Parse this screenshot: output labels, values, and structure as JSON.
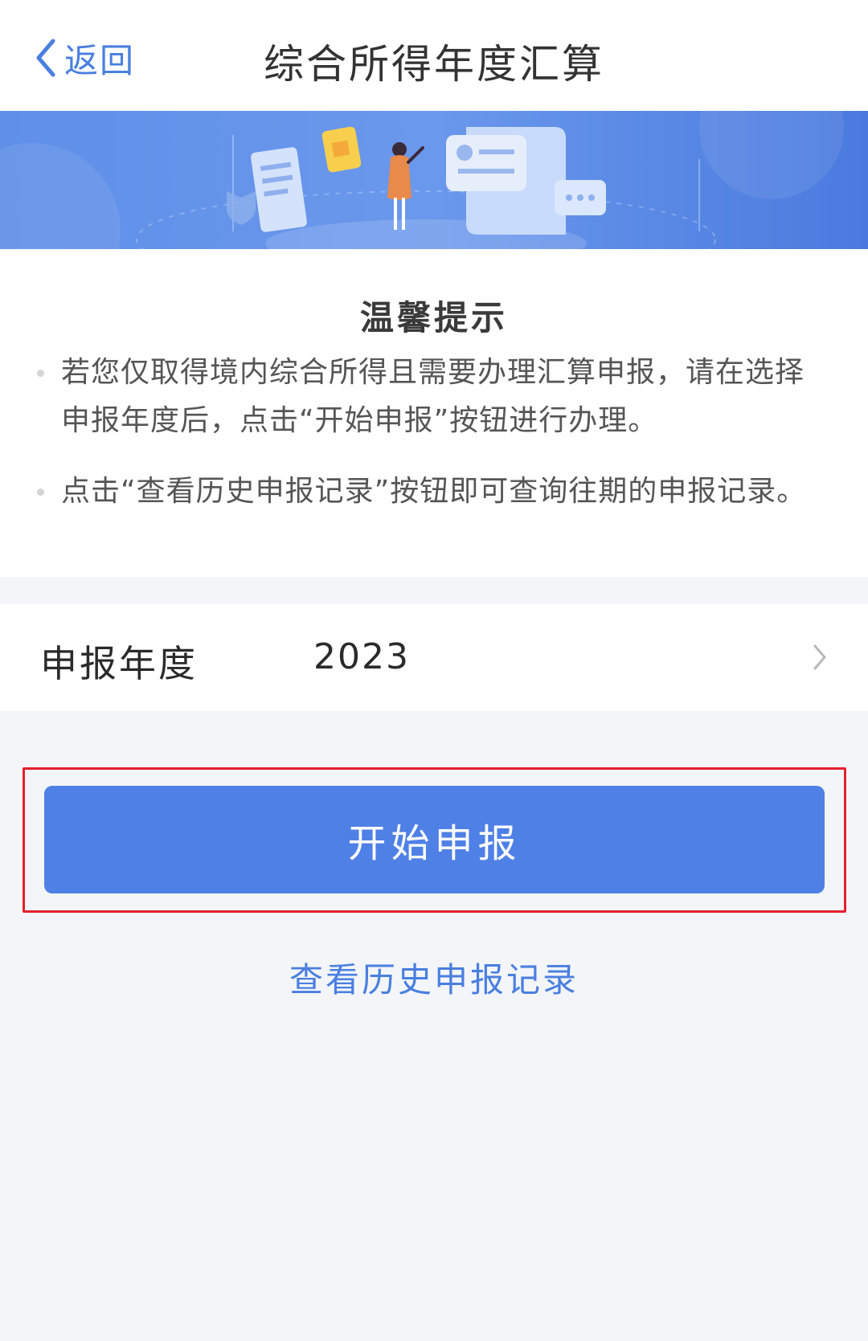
{
  "navbar": {
    "back_label": "返回",
    "title": "综合所得年度汇算"
  },
  "notice": {
    "title": "温馨提示",
    "items": [
      "若您仅取得境内综合所得且需要办理汇算申报，请在选择申报年度后，点击“开始申报”按钮进行办理。",
      "点击“查看历史申报记录”按钮即可查询往期的申报记录。"
    ]
  },
  "year_selector": {
    "label": "申报年度",
    "value": "2023"
  },
  "actions": {
    "start_label": "开始申报",
    "history_label": "查看历史申报记录"
  },
  "colors": {
    "accent": "#4f80e6",
    "link": "#4a7fe0",
    "banner": "#4c7fe0",
    "highlight": "#e5202e",
    "page_bg": "#f3f5f9"
  }
}
